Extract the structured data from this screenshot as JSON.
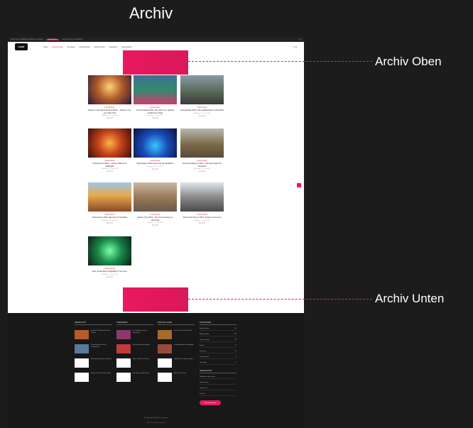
{
  "header": {
    "title": "Archiv"
  },
  "topbar": {
    "items": [
      "RESTORE: HYPERBEATZ FESTIVAL 2024 DATES",
      "NEWSFLASH",
      "FESTIVAL GUIDE & PRE-PARTY"
    ],
    "social": "f t ig"
  },
  "nav": {
    "logo": "HARD",
    "items": [
      "Home",
      "Festival Guide",
      "Interviews",
      "Artist Reviews",
      "Aktuelle News",
      "Newsletter",
      "Gewinnspiele"
    ],
    "icons": "f t ig"
  },
  "cards": [
    {
      "cat": "Festival News",
      "title": "Defqon.1 Weekend Festival 2024 – Tickets, Line-up & alle Infos",
      "meta": "Redaktion · 12. Juni 2024",
      "share": "♥ f ✈ ✉"
    },
    {
      "cat": "Festival News",
      "title": "Tomorrowland 2024: Alle Infos zum größten Festival der Welt",
      "meta": "Redaktion · 10. Juni 2024",
      "share": "♥ f ✈ ✉"
    },
    {
      "cat": "Festival News",
      "title": "Parookaville 2024: Das Stadtfestival im Überblick",
      "meta": "Redaktion · 08. Juni 2024",
      "share": "♥ f ✈ ✉"
    },
    {
      "cat": "Festival News",
      "title": "Ultra Europe 2024 – Lineup, Bühnen & Highlights",
      "meta": "Redaktion · 05. Juni 2024",
      "share": "♥ f ✈ ✉"
    },
    {
      "cat": "Festival News",
      "title": "Mysteryland 2024: Das sind die Headliner",
      "meta": "Redaktion · 03. Juni 2024",
      "share": "♥ f ✈ ✉"
    },
    {
      "cat": "Festival News",
      "title": "Sonnenaufgang im Zelt – Camping-Tipps für Festivals",
      "meta": "Redaktion · 01. Juni 2024",
      "share": "♥ f ✈ ✉"
    },
    {
      "cat": "Festival News",
      "title": "Airbeat One 2024: Alle Acts & Timetable",
      "meta": "Redaktion · 29. Mai 2024",
      "share": "♥ f ✈ ✉"
    },
    {
      "cat": "Festival News",
      "title": "Nature One 2024 – Die Sommerparty im Hunsrück",
      "meta": "Redaktion · 27. Mai 2024",
      "share": "♥ f ✈ ✉"
    },
    {
      "cat": "Festival News",
      "title": "World Club Dome 2024: Tickets und Lineup",
      "meta": "Redaktion · 25. Mai 2024",
      "share": "♥ f ✈ ✉"
    },
    {
      "cat": "Festival News",
      "title": "Das neuste Event-Highlight im Sommer",
      "meta": "Redaktion · 22. Mai 2024",
      "share": "♥ f ✈ ✉"
    }
  ],
  "footer": {
    "col1": {
      "heading": "NEWSFLASH",
      "items": [
        "Defqon.1 Weekend Festival Tickets",
        "Tomorrowland Line-up veröffentlicht",
        "Ultra Europe Bühnen bekannt",
        "Nature One Timetable online"
      ]
    },
    "col2": {
      "heading": "INTERVIEWS",
      "items": [
        "Im Gespräch mit den Headlinern",
        "Backstage beim Festival",
        "Neue Talente im Porträt",
        "Die Stimmen der Szene"
      ]
    },
    "col3": {
      "heading": "FESTIVAL GUIDE",
      "items": [
        "Die besten Festivals 2024",
        "Camping-Guide für Anfänger",
        "Packliste fürs Wochenende",
        "Anreise & Tickets"
      ]
    },
    "cat": {
      "heading": "KATEGORIEN",
      "rows": [
        [
          "Artist Reviews",
          "24"
        ],
        [
          "Aktuelle News",
          "152"
        ],
        [
          "Festival Guide",
          "38"
        ],
        [
          "Events",
          "17"
        ],
        [
          "Interviews",
          "21"
        ],
        [
          "Gewinnspiele",
          "9"
        ],
        [
          "Newsletter",
          "6"
        ]
      ],
      "subheading": "NEWSLETTER",
      "links": [
        "Newsletter abonnieren",
        "Datenschutz",
        "Impressum",
        "Kontakt"
      ],
      "button": "Jetzt abonnieren"
    },
    "bottom": "f Facebook   ▶ YouTube   ◎ Instagram",
    "copy": "© 2024 · Alle Rechte vorbehalten"
  },
  "labels": {
    "top": "Archiv Oben",
    "bottom": "Archiv Unten"
  },
  "colors": {
    "accent": "#e8195f",
    "background": "#1c1c1c"
  }
}
